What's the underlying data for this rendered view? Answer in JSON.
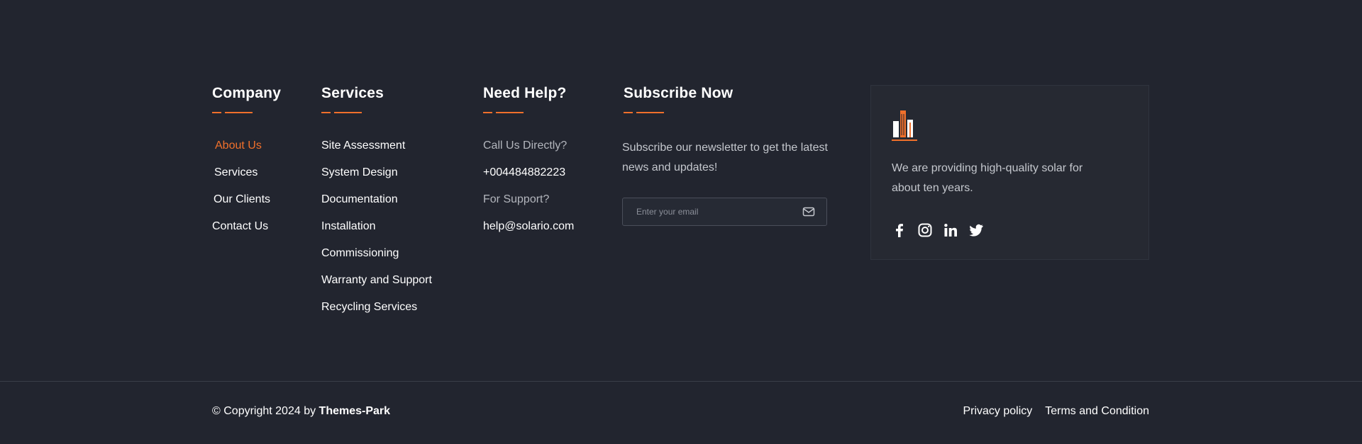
{
  "colors": {
    "background": "#22252f",
    "accent": "#f0702b",
    "card": "#262932",
    "muted_text": "#b3b6bd"
  },
  "company": {
    "title": "Company",
    "links": [
      {
        "label": "About Us",
        "active": true
      },
      {
        "label": "Services"
      },
      {
        "label": "Our Clients"
      },
      {
        "label": "Contact Us"
      }
    ]
  },
  "services": {
    "title": "Services",
    "links": [
      {
        "label": "Site Assessment"
      },
      {
        "label": "System Design"
      },
      {
        "label": "Documentation"
      },
      {
        "label": "Installation"
      },
      {
        "label": "Commissioning"
      },
      {
        "label": "Warranty and Support"
      },
      {
        "label": "Recycling Services"
      }
    ]
  },
  "help": {
    "title": "Need Help?",
    "call_label": "Call Us Directly?",
    "phone": "+004484882223",
    "support_label": "For Support?",
    "email": "help@solario.com"
  },
  "subscribe": {
    "title": "Subscribe Now",
    "text": "Subscribe our newsletter to get the latest news and updates!",
    "placeholder": "Enter your email",
    "submit_icon": "envelope-icon"
  },
  "about_card": {
    "logo_icon": "solar-building-logo",
    "text": "We are providing high-quality solar for about ten years.",
    "socials": [
      "facebook-icon",
      "instagram-icon",
      "linkedin-icon",
      "twitter-icon"
    ]
  },
  "bottom": {
    "copyright_prefix": "© Copyright 2024 by ",
    "copyright_brand": "Themes-Park",
    "links": [
      "Privacy policy",
      "Terms and Condition"
    ]
  }
}
